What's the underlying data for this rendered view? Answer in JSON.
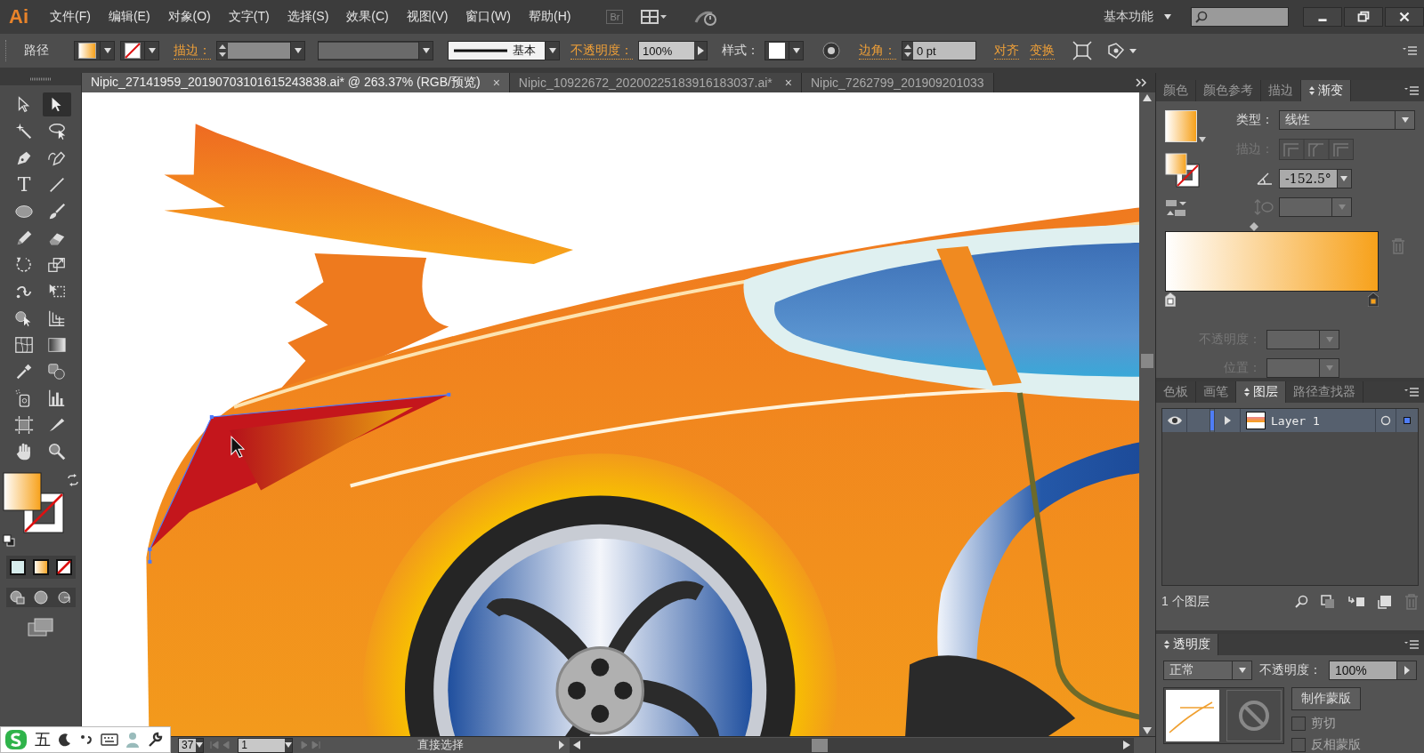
{
  "app": {
    "logo": "Ai",
    "menus": [
      "文件(F)",
      "编辑(E)",
      "对象(O)",
      "文字(T)",
      "选择(S)",
      "效果(C)",
      "视图(V)",
      "窗口(W)",
      "帮助(H)"
    ],
    "bridge": "Br",
    "workspace": "基本功能"
  },
  "control_bar": {
    "selection": "路径",
    "stroke_label": "描边：",
    "stroke_profile": "基本",
    "opacity_label": "不透明度：",
    "opacity": "100%",
    "style_label": "样式：",
    "corner_label": "边角：",
    "corner": "0 pt",
    "align": "对齐",
    "transform": "变换"
  },
  "documents": [
    {
      "title": "Nipic_27141959_20190703101615243838.ai* @ 263.37% (RGB/预览)",
      "close": "×",
      "selected": true
    },
    {
      "title": "Nipic_10922672_20200225183916183037.ai*",
      "close": "×",
      "selected": false
    },
    {
      "title": "Nipic_7262799_201909201033",
      "selected": false
    }
  ],
  "tools": [
    {
      "kind": "selection",
      "selected": false
    },
    {
      "kind": "direct-selection",
      "selected": true
    },
    {
      "kind": "magic-wand",
      "selected": false
    },
    {
      "kind": "lasso",
      "selected": false
    },
    {
      "kind": "pen",
      "selected": false
    },
    {
      "kind": "curvature",
      "selected": false
    },
    {
      "kind": "type",
      "glyph": "T",
      "selected": false
    },
    {
      "kind": "line",
      "selected": false
    },
    {
      "kind": "ellipse",
      "selected": false
    },
    {
      "kind": "brush",
      "selected": false
    },
    {
      "kind": "pencil",
      "selected": false
    },
    {
      "kind": "eraser",
      "selected": false
    },
    {
      "kind": "rotate",
      "selected": false
    },
    {
      "kind": "scale",
      "selected": false
    },
    {
      "kind": "puppet",
      "selected": false
    },
    {
      "kind": "free-transform",
      "selected": false
    },
    {
      "kind": "shape-builder",
      "selected": false
    },
    {
      "kind": "perspective",
      "selected": false
    },
    {
      "kind": "mesh",
      "selected": false
    },
    {
      "kind": "gradient",
      "selected": false
    },
    {
      "kind": "eyedropper",
      "selected": false
    },
    {
      "kind": "blend",
      "selected": false
    },
    {
      "kind": "sprayer",
      "selected": false
    },
    {
      "kind": "graph",
      "selected": false
    },
    {
      "kind": "artboard",
      "selected": false
    },
    {
      "kind": "slice",
      "selected": false
    },
    {
      "kind": "hand",
      "selected": false
    },
    {
      "kind": "zoom",
      "selected": false
    }
  ],
  "status_bar": {
    "zoom": "37",
    "artboard": "1",
    "tool": "直接选择"
  },
  "gradient_panel": {
    "tabs": [
      {
        "label": "颜色",
        "selected": false
      },
      {
        "label": "颜色参考",
        "selected": false
      },
      {
        "label": "描边",
        "selected": false
      },
      {
        "label": "渐变",
        "selected": true
      }
    ],
    "type_label": "类型：",
    "type": "线性",
    "stroke_label": "描边：",
    "angle": "-152.5°",
    "stops": [
      {
        "color": "#ffffff",
        "selected": false
      },
      {
        "color": "#f7a11a",
        "selected": true
      }
    ],
    "opacity_label": "不透明度：",
    "location_label": "位置："
  },
  "layers_panel": {
    "tabs": [
      {
        "label": "色板",
        "selected": false
      },
      {
        "label": "画笔",
        "selected": false
      },
      {
        "label": "图层",
        "selected": true
      },
      {
        "label": "路径查找器",
        "selected": false
      }
    ],
    "layers": [
      {
        "name": "Layer 1",
        "visible": true,
        "expanded": false,
        "color": "#4f7df5"
      }
    ],
    "count": "1 个图层"
  },
  "transparency_panel": {
    "title": "透明度",
    "blend_mode": "正常",
    "opacity_label": "不透明度：",
    "opacity": "100%",
    "make_mask": "制作蒙版",
    "options": [
      {
        "label": "剪切",
        "checked": false
      },
      {
        "label": "反相蒙版",
        "checked": false
      }
    ]
  },
  "input_method": {
    "mode": "五"
  }
}
